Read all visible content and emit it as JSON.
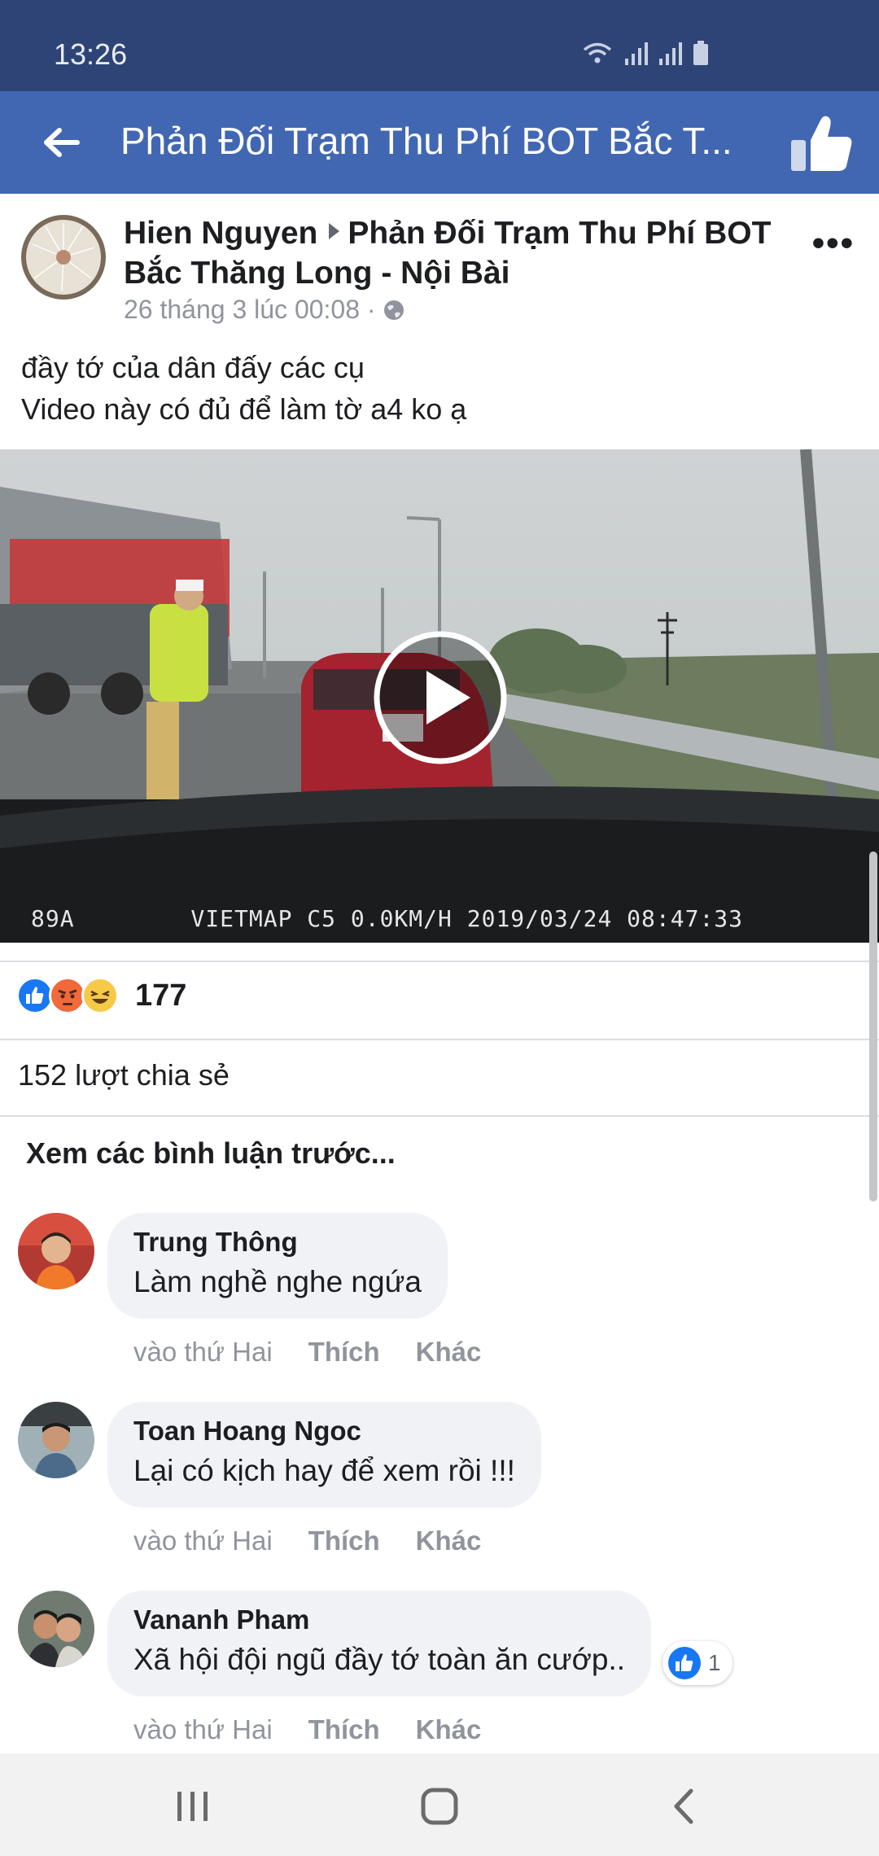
{
  "status_bar": {
    "time": "13:26"
  },
  "app_bar": {
    "title": "Phản Đối Trạm Thu Phí BOT Bắc T..."
  },
  "post": {
    "author": "Hien Nguyen",
    "group": "Phản Đối Trạm Thu Phí BOT Bắc Thăng Long - Nội Bài",
    "timestamp": "26 tháng 3 lúc 00:08 ·",
    "text_line1": "đầy tớ của dân đấy các cụ",
    "text_line2": "Video này có đủ để làm tờ a4 ko ạ",
    "video_overlay": "89A        VIETMAP C5 0.0KM/H 2019/03/24 08:47:33",
    "reaction_count": "177",
    "reactions": [
      "like",
      "angry",
      "haha"
    ],
    "shares": "152 lượt chia sẻ"
  },
  "comments_header": "Xem các bình luận trước...",
  "comments": [
    {
      "name": "Trung Thông",
      "text": "Làm nghề nghe ngứa",
      "time": "vào thứ Hai",
      "like": "Thích",
      "more": "Khác"
    },
    {
      "name": "Toan Hoang Ngoc",
      "text": "Lại có kịch hay để xem rồi !!!",
      "time": "vào thứ Hai",
      "like": "Thích",
      "more": "Khác"
    },
    {
      "name": "Vananh Pham",
      "text": "Xã hội đội ngũ đầy tớ toàn ăn cướp..",
      "time": "vào thứ Hai",
      "like": "Thích",
      "more": "Khác",
      "like_count": "1"
    }
  ],
  "colors": {
    "brand": "#4267b2",
    "status_bar": "#2f4476",
    "bubble": "#f0f2f5",
    "muted": "#90949c"
  },
  "icons": [
    "wifi-icon",
    "signal-icon",
    "battery-icon",
    "back-arrow-icon",
    "thumbs-up-icon",
    "globe-icon",
    "more-icon",
    "play-icon",
    "recents-icon",
    "home-icon",
    "back-icon"
  ]
}
